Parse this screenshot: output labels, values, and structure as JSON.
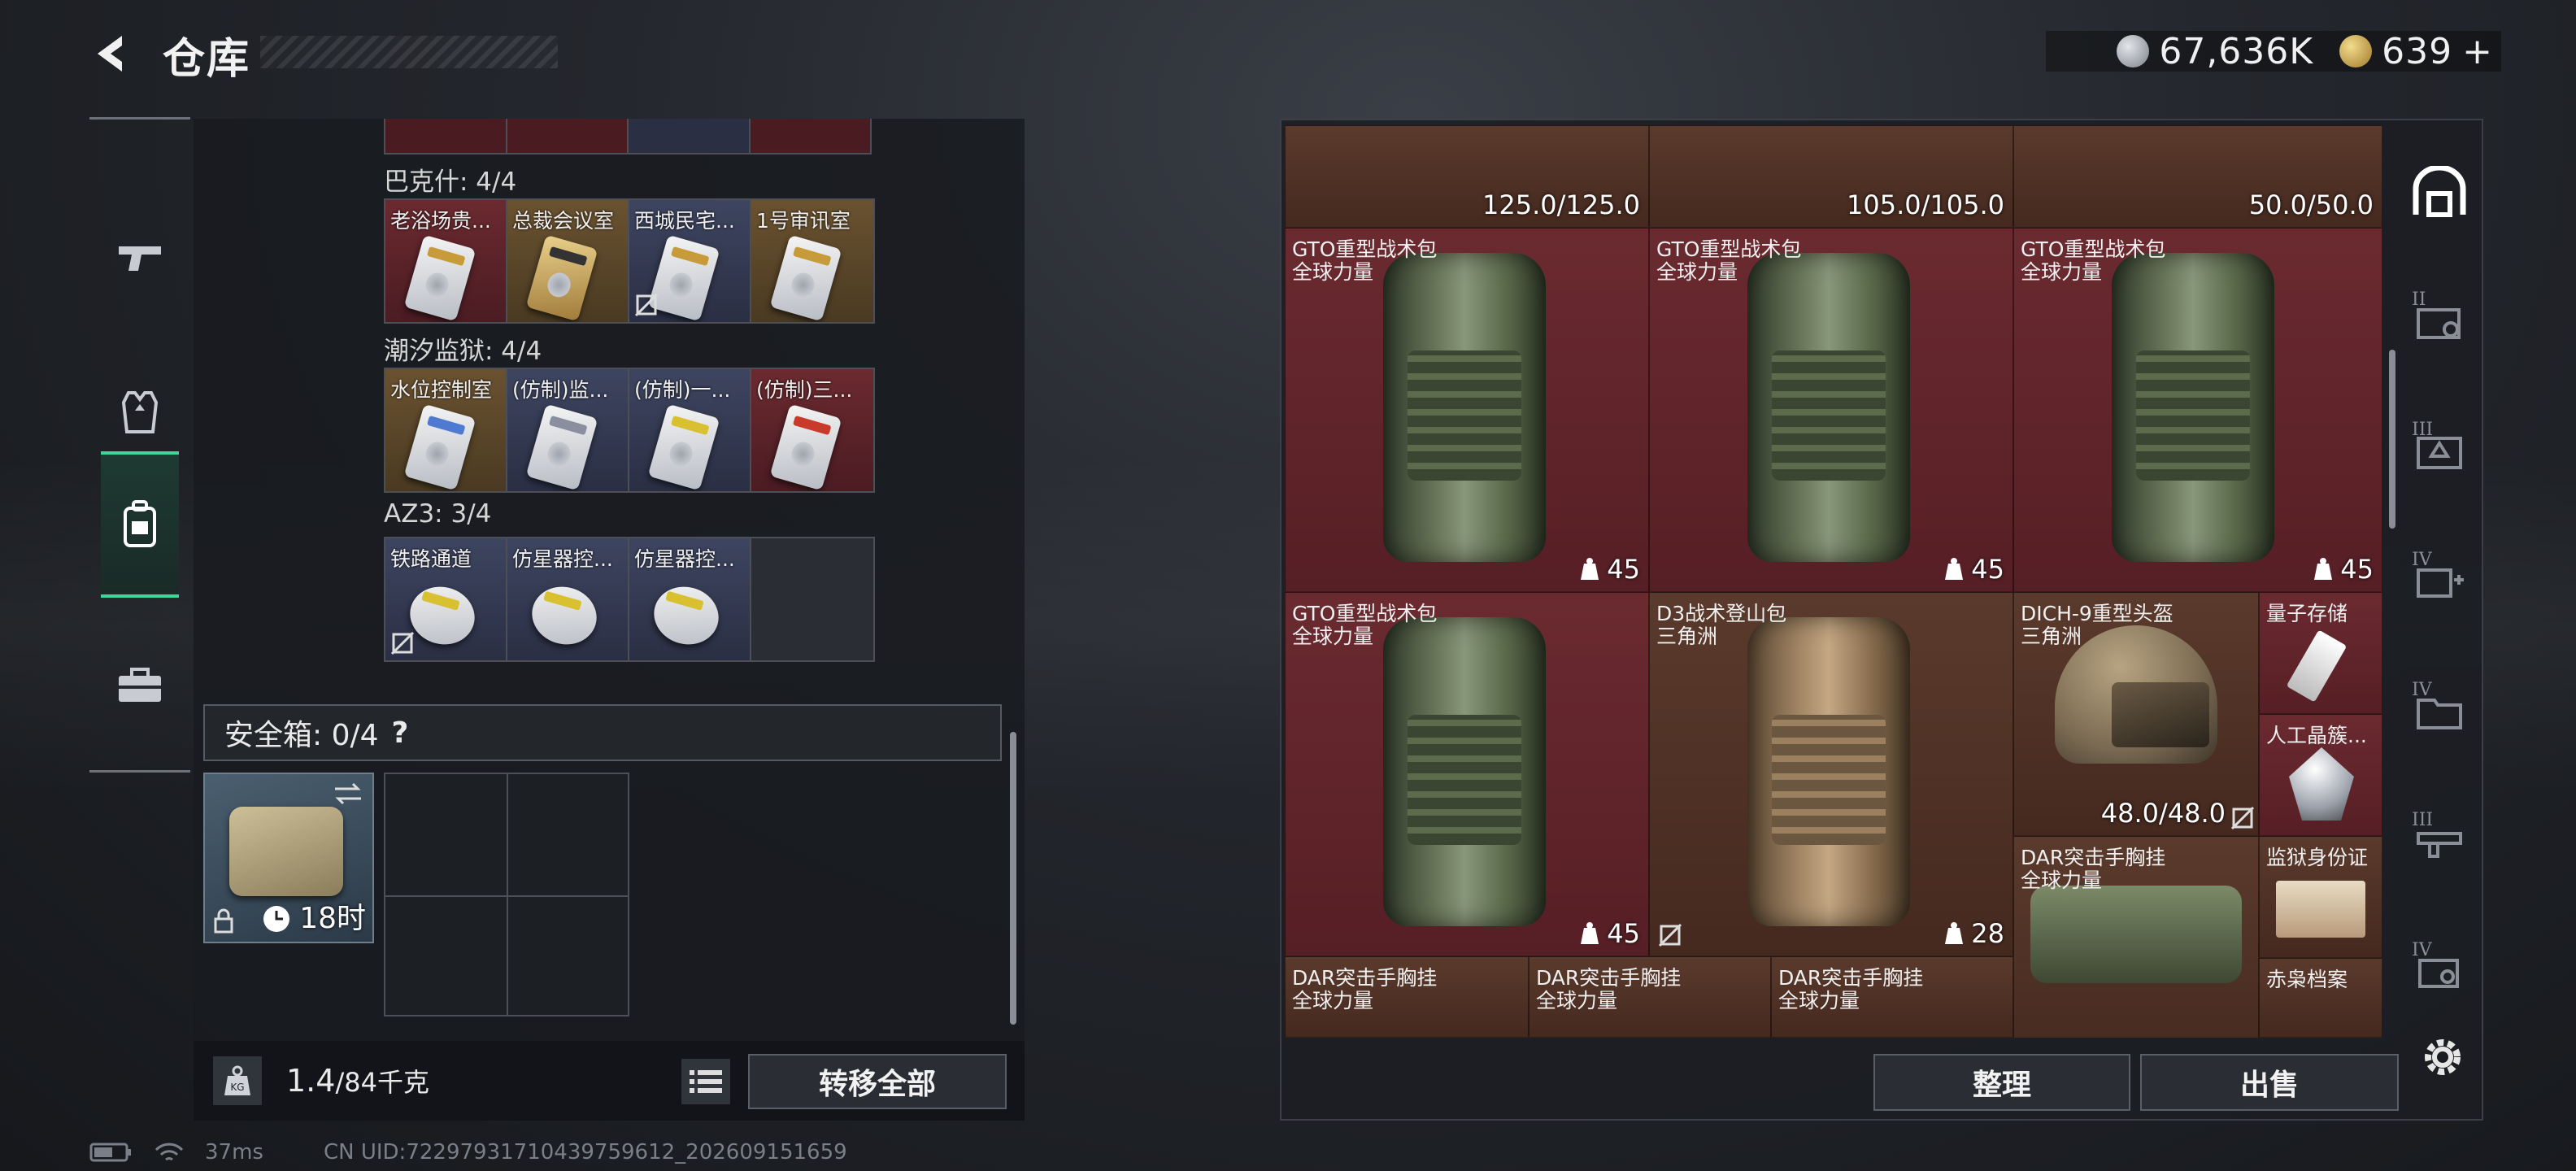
{
  "header": {
    "title": "仓库",
    "currency1": "67,636K",
    "currency2": "639",
    "plus": "+"
  },
  "groups": [
    {
      "label": "巴克什: 4/4",
      "items": [
        {
          "name": "老浴场贵...",
          "color": "red",
          "trade_locked": false
        },
        {
          "name": "总裁会议室",
          "color": "gold",
          "trade_locked": false
        },
        {
          "name": "西城民宅...",
          "color": "blue",
          "trade_locked": true
        },
        {
          "name": "1号审讯室",
          "color": "gold",
          "trade_locked": false
        }
      ]
    },
    {
      "label": "潮汐监狱: 4/4",
      "items": [
        {
          "name": "水位控制室",
          "color": "gold",
          "trade_locked": false
        },
        {
          "name": "(仿制)监...",
          "color": "blue",
          "trade_locked": false
        },
        {
          "name": "(仿制)一...",
          "color": "blue",
          "trade_locked": false
        },
        {
          "name": "(仿制)三...",
          "color": "red",
          "trade_locked": false
        }
      ]
    },
    {
      "label": "AZ3: 3/4",
      "items": [
        {
          "name": "铁路通道",
          "color": "blue",
          "trade_locked": true
        },
        {
          "name": "仿星器控...",
          "color": "blue",
          "trade_locked": false
        },
        {
          "name": "仿星器控...",
          "color": "blue",
          "trade_locked": false
        },
        {
          "name": "",
          "color": "dark",
          "trade_locked": false
        }
      ]
    }
  ],
  "safe": {
    "title": "安全箱: 0/4",
    "help": "?",
    "timer": "18时"
  },
  "weight": {
    "current": "1.4",
    "max": "/84千克"
  },
  "buttons": {
    "transfer_all": "转移全部",
    "sort": "整理",
    "sell": "出售"
  },
  "inventory": {
    "top_row": [
      {
        "durability": "125.0/125.0"
      },
      {
        "durability": "105.0/105.0"
      },
      {
        "durability": "50.0/50.0"
      }
    ],
    "items": [
      {
        "name": "GTO重型战术包",
        "sub": "全球力量",
        "count": "45"
      },
      {
        "name": "GTO重型战术包",
        "sub": "全球力量",
        "count": "45"
      },
      {
        "name": "GTO重型战术包",
        "sub": "全球力量",
        "count": "45"
      },
      {
        "name": "GTO重型战术包",
        "sub": "全球力量",
        "count": "45"
      },
      {
        "name": "D3战术登山包",
        "sub": "三角洲",
        "count": "28"
      },
      {
        "name": "DICH-9重型头盔",
        "sub": "三角洲",
        "durability": "48.0/48.0"
      },
      {
        "name": "量子存储"
      },
      {
        "name": "人工晶簇..."
      },
      {
        "name": "DAR突击手胸挂",
        "sub": "全球力量"
      },
      {
        "name": "监狱身份证"
      },
      {
        "name": "DAR突击手胸挂",
        "sub": "全球力量"
      },
      {
        "name": "DAR突击手胸挂",
        "sub": "全球力量"
      },
      {
        "name": "DAR突击手胸挂",
        "sub": "全球力量"
      },
      {
        "name": "赤枭档案"
      }
    ]
  },
  "right_tabs": [
    "II",
    "III",
    "IV",
    "IV",
    "III",
    "IV"
  ],
  "status": {
    "ping": "37ms",
    "uid": "CN UID:722979317104397596​12_202609151659"
  },
  "colors": {
    "accent": "#3fd69a",
    "maroon": "#5d2228"
  }
}
